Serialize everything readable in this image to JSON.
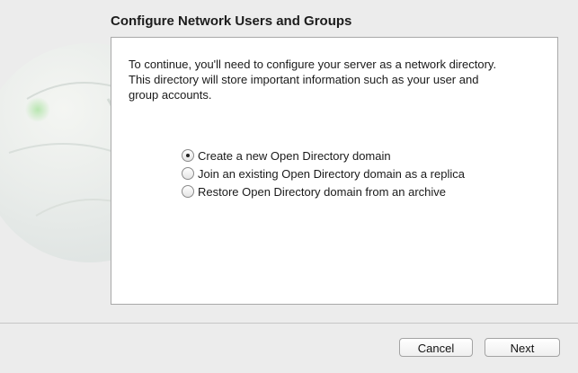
{
  "header": {
    "title": "Configure Network Users and Groups"
  },
  "main": {
    "intro": "To continue, you'll need to configure your server as a network directory.\nThis directory will store important information such as your user and\ngroup accounts.",
    "options": [
      {
        "label": "Create a new Open Directory domain",
        "selected": true
      },
      {
        "label": "Join an existing Open Directory domain as a replica",
        "selected": false
      },
      {
        "label": "Restore Open Directory domain from an archive",
        "selected": false
      }
    ]
  },
  "footer": {
    "cancel_label": "Cancel",
    "next_label": "Next"
  },
  "icons": {
    "background": "globe-icon"
  },
  "colors": {
    "window_bg": "#ececec",
    "panel_bg": "#ffffff",
    "panel_border": "#a9a9a9"
  }
}
